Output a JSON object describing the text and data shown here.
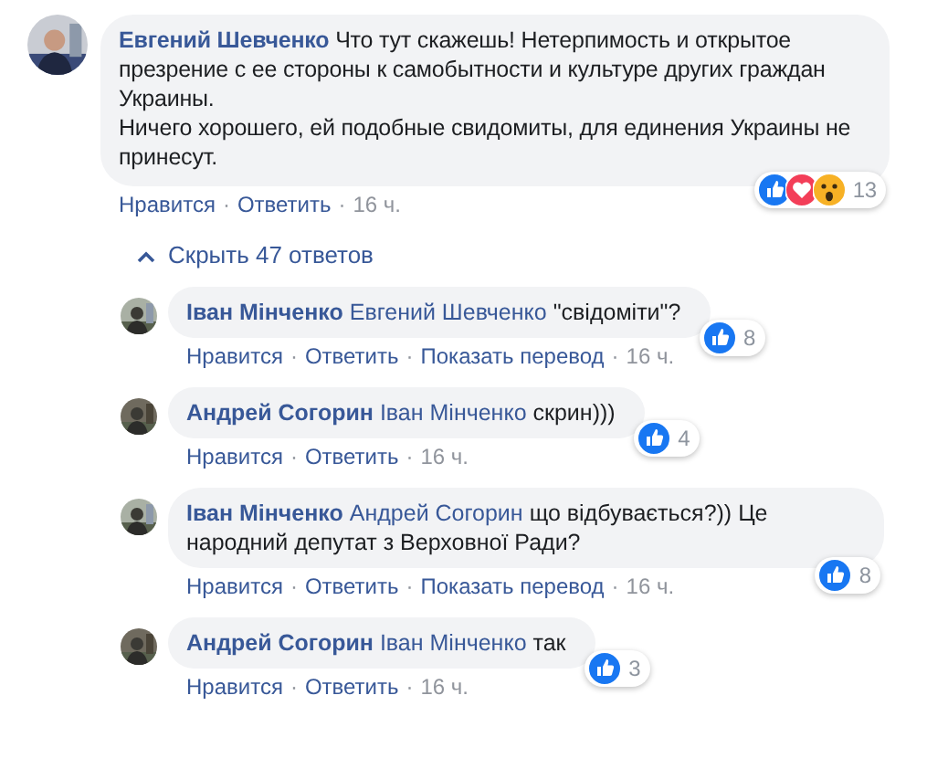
{
  "action_separator": "·",
  "comment": {
    "author": "Евгений Шевченко",
    "text": "Что тут скажешь! Нетерпимость и открытое презрение с ее стороны к самобытности и культуре других граждан Украины.\nНичего хорошего, ей подобные свидомиты, для единения Украины не принесут.",
    "reactions": [
      {
        "kind": "like"
      },
      {
        "kind": "love"
      },
      {
        "kind": "wow"
      }
    ],
    "reaction_count": "13",
    "actions": [
      "Нравится",
      "Ответить"
    ],
    "time": "16 ч."
  },
  "hide_replies": {
    "label": "Скрыть 47 ответов"
  },
  "replies": [
    {
      "author": "Іван Мінченко",
      "mention": "Евгений Шевченко",
      "text": "\"свідоміти\"?",
      "reactions": [
        {
          "kind": "like"
        }
      ],
      "reaction_count": "8",
      "actions": [
        "Нравится",
        "Ответить",
        "Показать перевод"
      ],
      "time": "16 ч."
    },
    {
      "author": "Андрей Согорин",
      "mention": "Іван Мінченко",
      "text": "скрин)))",
      "reactions": [
        {
          "kind": "like"
        }
      ],
      "reaction_count": "4",
      "actions": [
        "Нравится",
        "Ответить"
      ],
      "time": "16 ч."
    },
    {
      "author": "Іван Мінченко",
      "mention": "Андрей Согорин",
      "text": "що відбувається?)) Це народний депутат з Верховної Ради?",
      "reactions": [
        {
          "kind": "like"
        }
      ],
      "reaction_count": "8",
      "actions": [
        "Нравится",
        "Ответить",
        "Показать перевод"
      ],
      "time": "16 ч."
    },
    {
      "author": "Андрей Согорин",
      "mention": "Іван Мінченко",
      "text": "так",
      "reactions": [
        {
          "kind": "like"
        }
      ],
      "reaction_count": "3",
      "actions": [
        "Нравится",
        "Ответить"
      ],
      "time": "16 ч."
    }
  ]
}
